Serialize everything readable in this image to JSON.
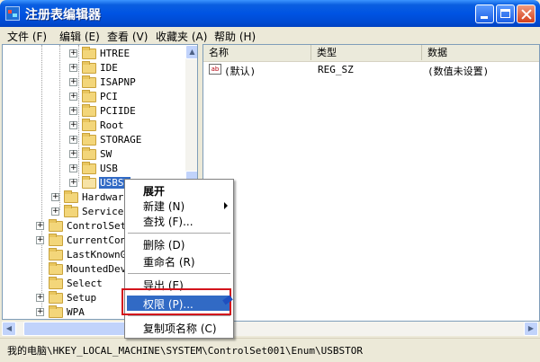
{
  "window": {
    "title": "注册表编辑器"
  },
  "menu": {
    "items": [
      "文件 (F)",
      "编辑 (E)",
      "查看 (V)",
      "收藏夹 (A)",
      "帮助 (H)"
    ]
  },
  "tree": {
    "nodes": [
      "HTREE",
      "IDE",
      "ISAPNP",
      "PCI",
      "PCIIDE",
      "Root",
      "STORAGE",
      "SW",
      "USB",
      "USBST",
      "Hardware",
      "Services",
      "ControlSetO",
      "CurrentCont",
      "LastKnownGo",
      "MountedDevi",
      "Select",
      "Setup",
      "WPA"
    ]
  },
  "list": {
    "columns": [
      "名称",
      "类型",
      "数据"
    ],
    "rows": [
      {
        "name": "(默认)",
        "type": "REG_SZ",
        "data": "(数值未设置)"
      }
    ]
  },
  "context_menu": {
    "expand": "展开",
    "new": "新建 (N)",
    "find": "查找 (F)...",
    "delete": "删除 (D)",
    "rename": "重命名 (R)",
    "export": "导出 (E)",
    "permissions": "权限 (P)...",
    "copy_key_name": "复制项名称 (C)"
  },
  "status": {
    "path": "我的电脑\\HKEY_LOCAL_MACHINE\\SYSTEM\\ControlSet001\\Enum\\USBSTOR"
  },
  "colors": {
    "title_blue": "#0054E3",
    "selection": "#316AC5",
    "highlight_box": "#D3141C"
  }
}
